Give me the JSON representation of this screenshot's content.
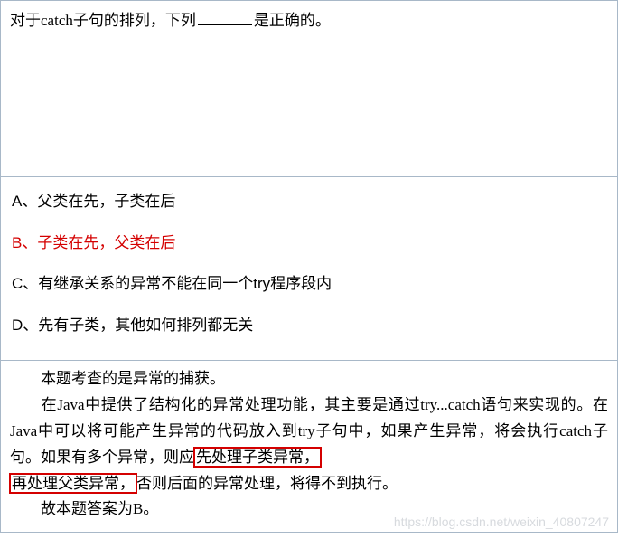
{
  "question": {
    "prefix": "对于catch子句的排列，下列",
    "suffix": "是正确的。"
  },
  "options": {
    "A": "A、父类在先，子类在后",
    "B": "B、子类在先，父类在后",
    "C": "C、有继承关系的异常不能在同一个try程序段内",
    "D": "D、先有子类，其他如何排列都无关",
    "correct": "B"
  },
  "explanation": {
    "line1": "本题考查的是异常的捕获。",
    "line2_pre": "在Java中提供了结构化的异常处理功能，其主要是通过try...catch语句来实现的。在Java中可以将可能产生异常的代码放入到try子句中，如果产生异常，将会执行catch子句。如果有多个异常，则应",
    "hl1": "先处理子类异常，",
    "hl2": "再处理父类异常，",
    "line2_post": "否则后面的异常处理，将得不到执行。",
    "line3": "故本题答案为B。"
  },
  "watermark": "https://blog.csdn.net/weixin_40807247"
}
